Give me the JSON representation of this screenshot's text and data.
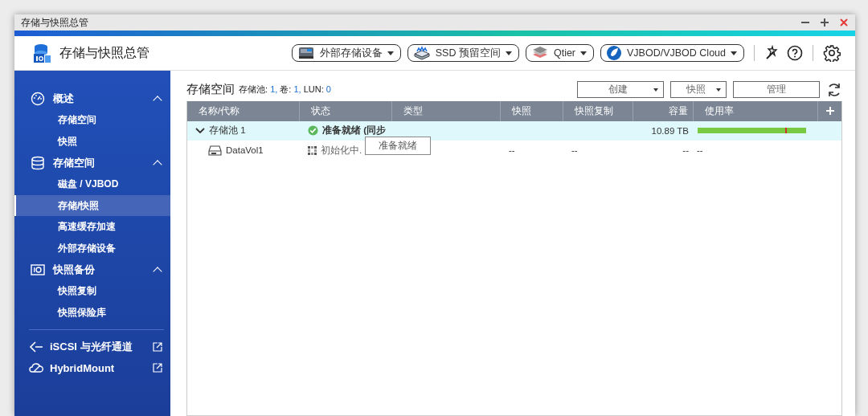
{
  "window": {
    "title": "存储与快照总管"
  },
  "app": {
    "title": "存储与快照总管",
    "toolbar": [
      {
        "label": "外部存储设备"
      },
      {
        "label": "SSD 预留空间"
      },
      {
        "label": "Qtier"
      },
      {
        "label": "VJBOD/VJBOD Cloud"
      }
    ]
  },
  "sidebar": {
    "groups": [
      {
        "label": "概述",
        "expanded": true,
        "items": [
          {
            "label": "存储空间",
            "selected": false
          },
          {
            "label": "快照",
            "selected": false
          }
        ]
      },
      {
        "label": "存储空间",
        "expanded": true,
        "items": [
          {
            "label": "磁盘 / VJBOD",
            "selected": false
          },
          {
            "label": "存储/快照",
            "selected": true
          },
          {
            "label": "高速缓存加速",
            "selected": false
          },
          {
            "label": "外部存储设备",
            "selected": false
          }
        ]
      },
      {
        "label": "快照备份",
        "expanded": true,
        "items": [
          {
            "label": "快照复制",
            "selected": false
          },
          {
            "label": "快照保险库",
            "selected": false
          }
        ]
      }
    ],
    "links": [
      {
        "label": "iSCSI 与光纤通道"
      },
      {
        "label": "HybridMount"
      }
    ]
  },
  "panel": {
    "title": "存储空间",
    "summary": [
      {
        "label": "存储池:",
        "value": "1,"
      },
      {
        "label": "卷:",
        "value": "1,"
      },
      {
        "label": "LUN:",
        "value": "0"
      }
    ],
    "actions": [
      {
        "label": "创建",
        "dropdown": true
      },
      {
        "label": "快照",
        "dropdown": true
      },
      {
        "label": "管理",
        "dropdown": false
      }
    ],
    "table": {
      "columns": [
        "名称/代称",
        "状态",
        "类型",
        "快照",
        "快照复制",
        "容量",
        "使用率"
      ],
      "rows": [
        {
          "name": "存储池 1",
          "expanded": true,
          "status": "准备就绪 (同步",
          "capacity": "10.89 TB",
          "usage": {
            "level": 1,
            "threshold": {
              "level": 0.81
            }
          },
          "children": [
            {
              "name": "DataVol1",
              "status": "初始化中.",
              "snapshots": "--",
              "replication": "--",
              "capacity": "--",
              "usage_text": "--"
            }
          ]
        }
      ]
    },
    "tooltip": "准备就绪"
  }
}
